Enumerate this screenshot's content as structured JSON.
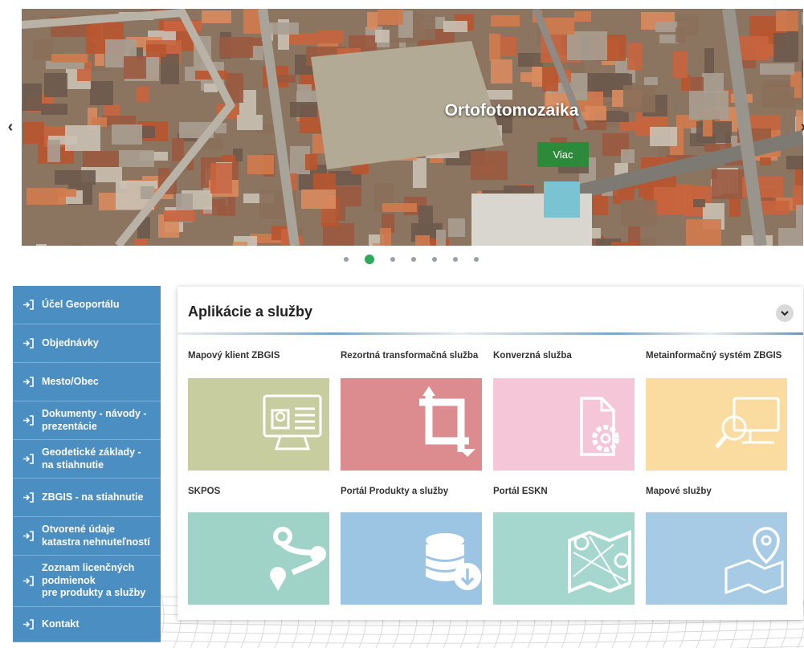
{
  "carousel": {
    "title": "Ortofotomozaika",
    "button_label": "Viac",
    "prev_label": "‹",
    "next_label": "›",
    "dots": [
      false,
      true,
      false,
      false,
      false,
      false,
      false
    ]
  },
  "sidebar": {
    "items": [
      {
        "label": "Účel Geoportálu"
      },
      {
        "label": "Objednávky"
      },
      {
        "label": "Mesto/Obec"
      },
      {
        "label": "Dokumenty - návody -\nprezentácie"
      },
      {
        "label": "Geodetické základy -\nna stiahnutie"
      },
      {
        "label": "ZBGIS - na stiahnutie"
      },
      {
        "label": "Otvorené údaje\nkatastra nehnuteľností"
      },
      {
        "label": "Zoznam licenčných\npodmienok\npre produkty a služby"
      },
      {
        "label": "Kontakt"
      }
    ]
  },
  "panel": {
    "title": "Aplikácie a služby",
    "tiles": [
      {
        "label": "Mapový klient ZBGIS",
        "color": "#c7cd9f",
        "icon": "monitor-map-icon"
      },
      {
        "label": "Rezortná transformačná služba",
        "color": "#dc8b8f",
        "icon": "crop-transform-icon"
      },
      {
        "label": "Konverzná služba",
        "color": "#f4c6d8",
        "icon": "document-gear-icon"
      },
      {
        "label": "Metainformačný systém ZBGIS",
        "color": "#fbdca0",
        "icon": "monitor-search-icon"
      },
      {
        "label": "SKPOS",
        "color": "#9fd3c7",
        "icon": "route-pins-icon"
      },
      {
        "label": "Portál Produkty a služby",
        "color": "#9cc5e3",
        "icon": "database-download-icon"
      },
      {
        "label": "Portál ESKN",
        "color": "#a6d7cf",
        "icon": "map-pin-icon"
      },
      {
        "label": "Mapové služby",
        "color": "#a7cbe5",
        "icon": "map-location-icon"
      }
    ]
  }
}
